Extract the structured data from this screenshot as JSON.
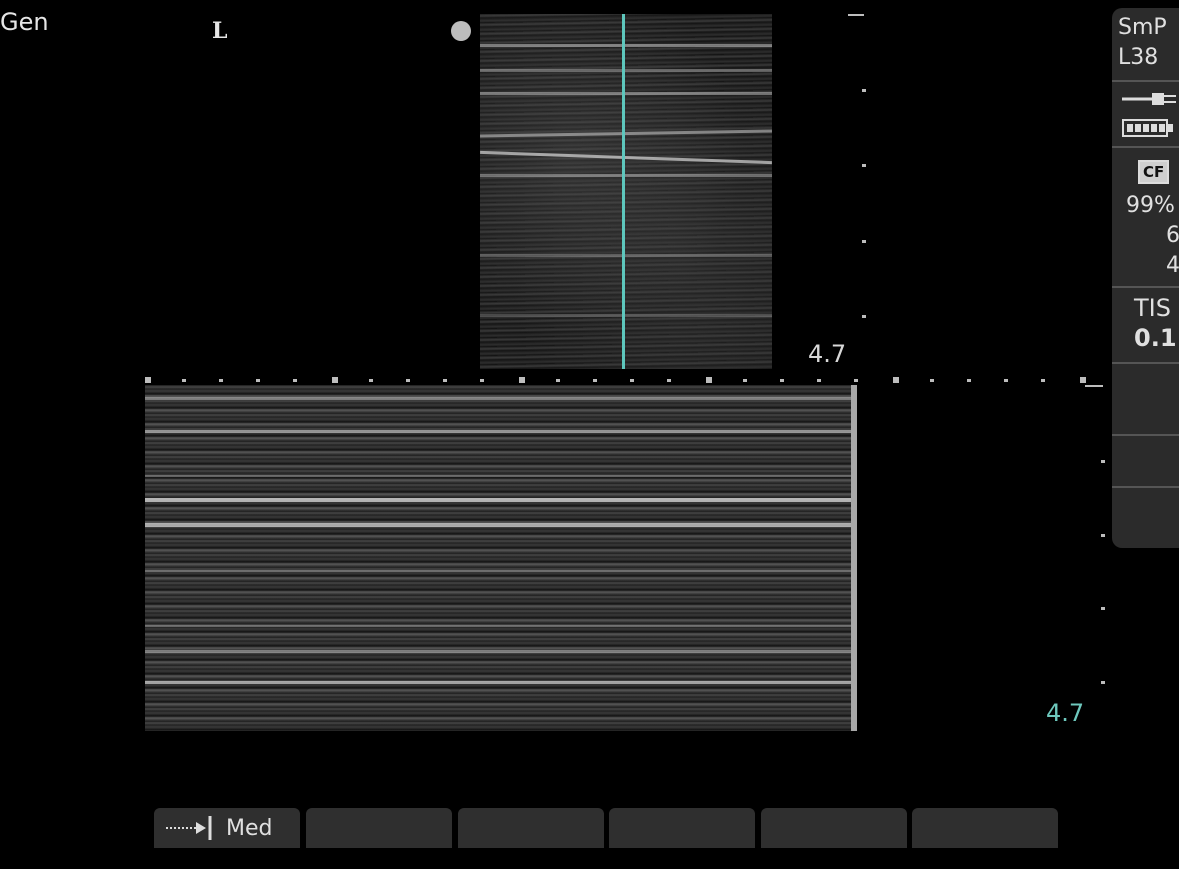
{
  "header": {
    "preset": "Gen",
    "orientation_marker": "L"
  },
  "b_mode": {
    "depth_label": "4.7"
  },
  "m_mode": {
    "depth_label": "4.7"
  },
  "side_panel": {
    "transducer_line1": "SmP",
    "transducer_line2": "L38",
    "power_icon": "power-plug-icon",
    "battery_icon": "battery-icon",
    "cf_badge": "CF",
    "gain_percent": "99%",
    "value_a": "6",
    "value_b": "4",
    "tis_label": "TIS",
    "tis_value": "0.1"
  },
  "softkeys": {
    "key1_icon": "arrow-to-line-icon",
    "key1_label": "Med",
    "key2_label": "",
    "key3_label": "",
    "key4_label": "",
    "key5_label": "",
    "key6_label": ""
  },
  "colors": {
    "accent_cyan": "#5ec7bd",
    "panel_bg": "#2b2b2b",
    "softkey_bg": "#2f2f2f"
  }
}
